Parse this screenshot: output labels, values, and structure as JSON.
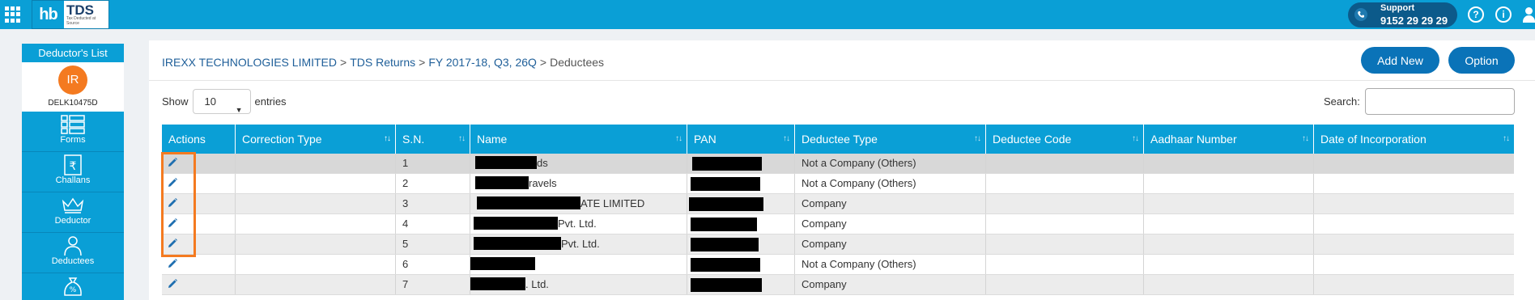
{
  "topbar": {
    "logo_hb": "hb",
    "logo_tds": "TDS",
    "logo_tagline": "Tax Deducted at Source",
    "support_label": "Support",
    "support_number": "9152 29 29 29",
    "help_icon": "?",
    "info_icon": "i"
  },
  "sidebar": {
    "title": "Deductor's List",
    "avatar_initials": "IR",
    "deductor_code": "DELK10475D",
    "items": [
      {
        "label": "Forms",
        "icon": "forms-icon"
      },
      {
        "label": "Challans",
        "icon": "challans-icon"
      },
      {
        "label": "Deductor",
        "icon": "crown-icon"
      },
      {
        "label": "Deductees",
        "icon": "deductees-icon"
      },
      {
        "label": "",
        "icon": "money-bag-icon"
      }
    ]
  },
  "breadcrumb": {
    "items": [
      "IREXX TECHNOLOGIES LIMITED",
      "TDS Returns",
      "FY 2017-18, Q3, 26Q"
    ],
    "separator": ">",
    "current": "Deductees"
  },
  "actions": {
    "add_new": "Add New",
    "option": "Option"
  },
  "table_controls": {
    "show_label": "Show",
    "entries_value": "10",
    "entries_label": "entries",
    "search_label": "Search:"
  },
  "table": {
    "columns": [
      "Actions",
      "Correction Type",
      "S.N.",
      "Name",
      "PAN",
      "Deductee Type",
      "Deductee Code",
      "Aadhaar Number",
      "Date of Incorporation"
    ],
    "rows": [
      {
        "sn": "1",
        "name": "ds",
        "deductee_type": "Not a Company (Others)"
      },
      {
        "sn": "2",
        "name": "ravels",
        "deductee_type": "Not a Company (Others)"
      },
      {
        "sn": "3",
        "name": "ATE LIMITED",
        "deductee_type": "Company"
      },
      {
        "sn": "4",
        "name": "Pvt. Ltd.",
        "deductee_type": "Company"
      },
      {
        "sn": "5",
        "name": "Pvt. Ltd.",
        "deductee_type": "Company"
      },
      {
        "sn": "6",
        "name": "",
        "deductee_type": "Not a Company (Others)"
      },
      {
        "sn": "7",
        "name": ". Ltd.",
        "deductee_type": "Company"
      }
    ]
  },
  "colors": {
    "primary": "#0a9fd6",
    "button": "#0a73b8",
    "avatar": "#f47a20",
    "highlight": "#f47a20"
  }
}
